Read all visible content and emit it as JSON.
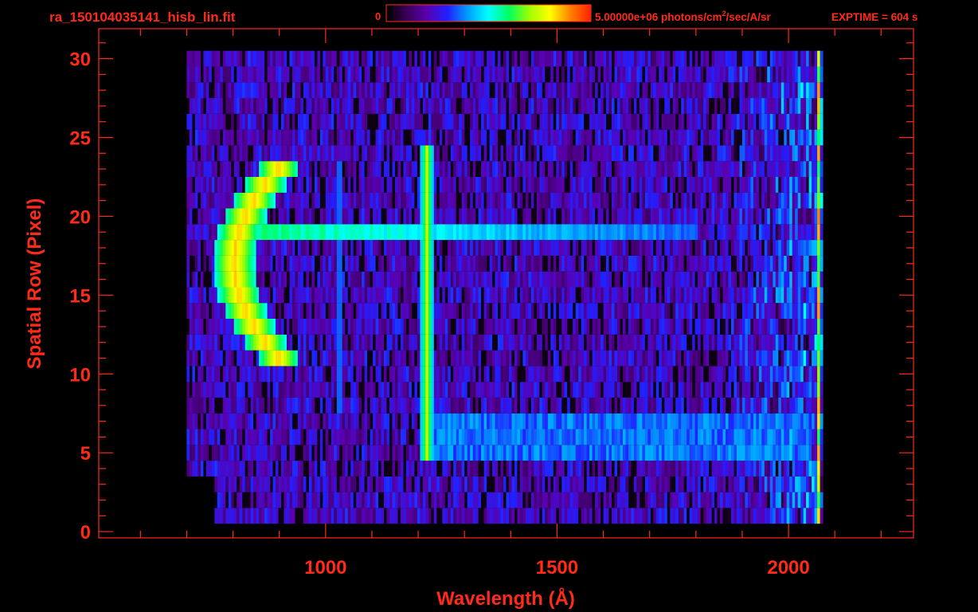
{
  "header": {
    "filename": "ra_150104035141_hisb_lin.fit",
    "colorbar_min": "0",
    "colorbar_max_text_pre": "5.00000e+06 photons/cm",
    "colorbar_max_sup": "2",
    "colorbar_max_text_post": "/sec/A/sr",
    "exptime": "EXPTIME = 604 s"
  },
  "colors": {
    "background": "#000000",
    "axis": "#ff2a1a",
    "colormap": [
      "#000000",
      "#3a0058",
      "#5a00b0",
      "#2020ff",
      "#00a0ff",
      "#00ffff",
      "#00ff60",
      "#a0ff00",
      "#ffff00",
      "#ff8000",
      "#ff2000"
    ]
  },
  "chart_data": {
    "type": "heatmap",
    "xlabel": "Wavelength (Å)",
    "ylabel": "Spatial Row (Pixel)",
    "xlim": [
      510,
      2270
    ],
    "ylim": [
      -0.4,
      31.9
    ],
    "x_ticks": [
      1000,
      1500,
      2000
    ],
    "y_ticks": [
      0,
      5,
      10,
      15,
      20,
      25,
      30
    ],
    "x_minor_step": 100,
    "y_minor_step": 1,
    "color_scale": [
      0,
      5000000
    ],
    "color_units": "photons/cm^2/sec/A/sr",
    "data_extent": {
      "x": [
        700,
        2070
      ],
      "rows": [
        1,
        30
      ]
    },
    "features": [
      {
        "name": "Ly-alpha line",
        "wavelength": 1216,
        "rows": [
          5,
          24
        ],
        "peak_level": 0.75
      },
      {
        "name": "faint line",
        "wavelength": 1026,
        "rows": [
          8,
          23
        ],
        "peak_level": 0.35
      },
      {
        "name": "arc emission",
        "wavelength_range": [
          790,
          960
        ],
        "rows": [
          11,
          23
        ],
        "peak_level": 0.85
      },
      {
        "name": "bright row",
        "row": 19,
        "wavelength_range": [
          840,
          1800
        ],
        "peak_level": 0.4
      },
      {
        "name": "detector edge",
        "wavelength": 2062,
        "rows": [
          1,
          30
        ],
        "peak_level": 0.6
      }
    ]
  }
}
